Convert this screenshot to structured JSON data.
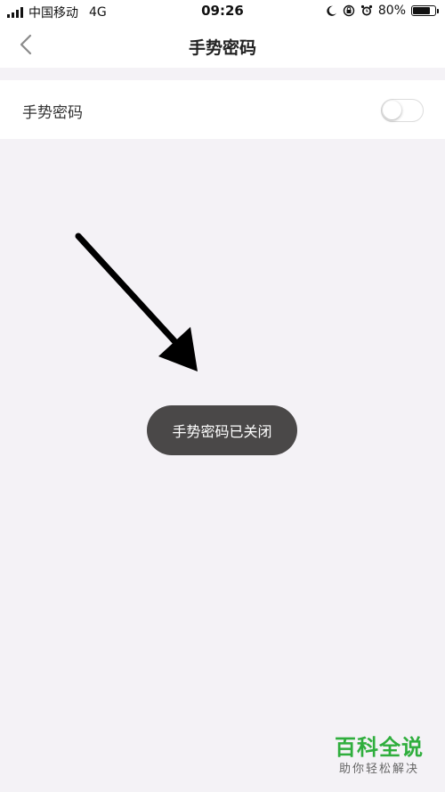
{
  "status_bar": {
    "carrier": "中国移动",
    "network": "4G",
    "time": "09:26",
    "battery_percent": "80%",
    "battery_level": 0.8,
    "icons": [
      "signal-icon",
      "moon-icon",
      "lock-rotation-icon",
      "alarm-icon",
      "battery-icon"
    ]
  },
  "nav": {
    "title": "手势密码",
    "back_icon": "chevron-left-icon"
  },
  "settings": {
    "gesture_password_label": "手势密码",
    "gesture_password_enabled": false
  },
  "toast": {
    "message": "手势密码已关闭"
  },
  "annotation": {
    "arrow_icon": "arrow-down-right-icon",
    "color": "#000000"
  },
  "watermark": {
    "title": "百科全说",
    "subtitle": "助你轻松解决"
  },
  "colors": {
    "background": "#f4f2f6",
    "toast_bg": "#4a4848",
    "watermark_green": "#2fae3d"
  }
}
